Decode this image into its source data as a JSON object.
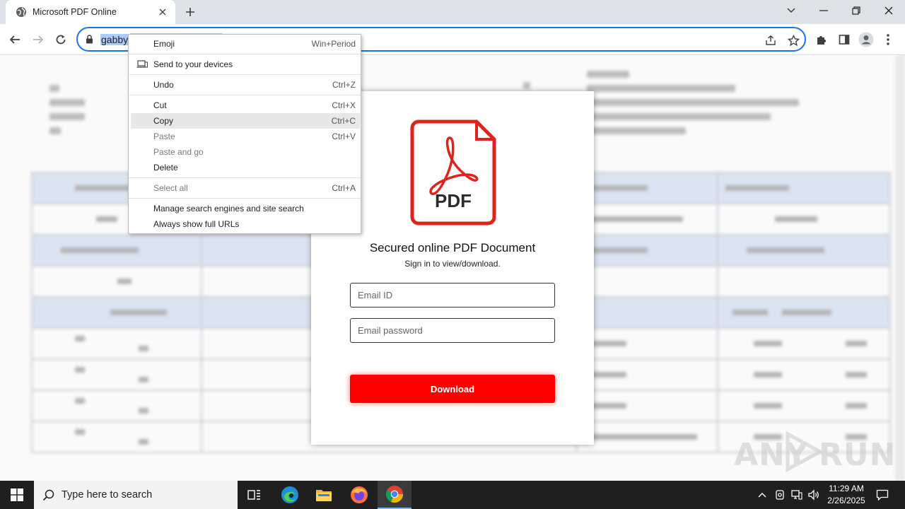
{
  "browser": {
    "tab": {
      "title": "Microsoft PDF Online"
    },
    "address_bar": {
      "selected_text": "gabby"
    }
  },
  "context_menu": {
    "items": [
      {
        "label": "Emoji",
        "shortcut": "Win+Period",
        "state": "normal"
      },
      {
        "label": "Send to your devices",
        "shortcut": "",
        "state": "normal",
        "icon": "laptop-phone-icon"
      },
      {
        "label": "Undo",
        "shortcut": "Ctrl+Z",
        "state": "normal"
      },
      {
        "label": "Cut",
        "shortcut": "Ctrl+X",
        "state": "normal"
      },
      {
        "label": "Copy",
        "shortcut": "Ctrl+C",
        "state": "highlighted"
      },
      {
        "label": "Paste",
        "shortcut": "Ctrl+V",
        "state": "disabled"
      },
      {
        "label": "Paste and go",
        "shortcut": "",
        "state": "disabled"
      },
      {
        "label": "Delete",
        "shortcut": "",
        "state": "normal"
      },
      {
        "label": "Select all",
        "shortcut": "Ctrl+A",
        "state": "disabled"
      },
      {
        "label": "Manage search engines and site search",
        "shortcut": "",
        "state": "normal"
      },
      {
        "label": "Always show full URLs",
        "shortcut": "",
        "state": "normal"
      }
    ]
  },
  "modal": {
    "logo_text": "PDF",
    "title": "Secured online PDF Document",
    "subtitle": "Sign in to view/download.",
    "email_placeholder": "Email ID",
    "password_placeholder": "Email password",
    "button_label": "Download"
  },
  "watermark": {
    "left": "ANY",
    "right": "RUN"
  },
  "taskbar": {
    "search_placeholder": "Type here to search",
    "time": "11:29 AM",
    "date": "2/26/2025"
  },
  "colors": {
    "accent_blue": "#1a73e8",
    "download_red": "#ff0000",
    "pdf_red": "#e0231c",
    "taskbar": "#1f1f1f"
  }
}
